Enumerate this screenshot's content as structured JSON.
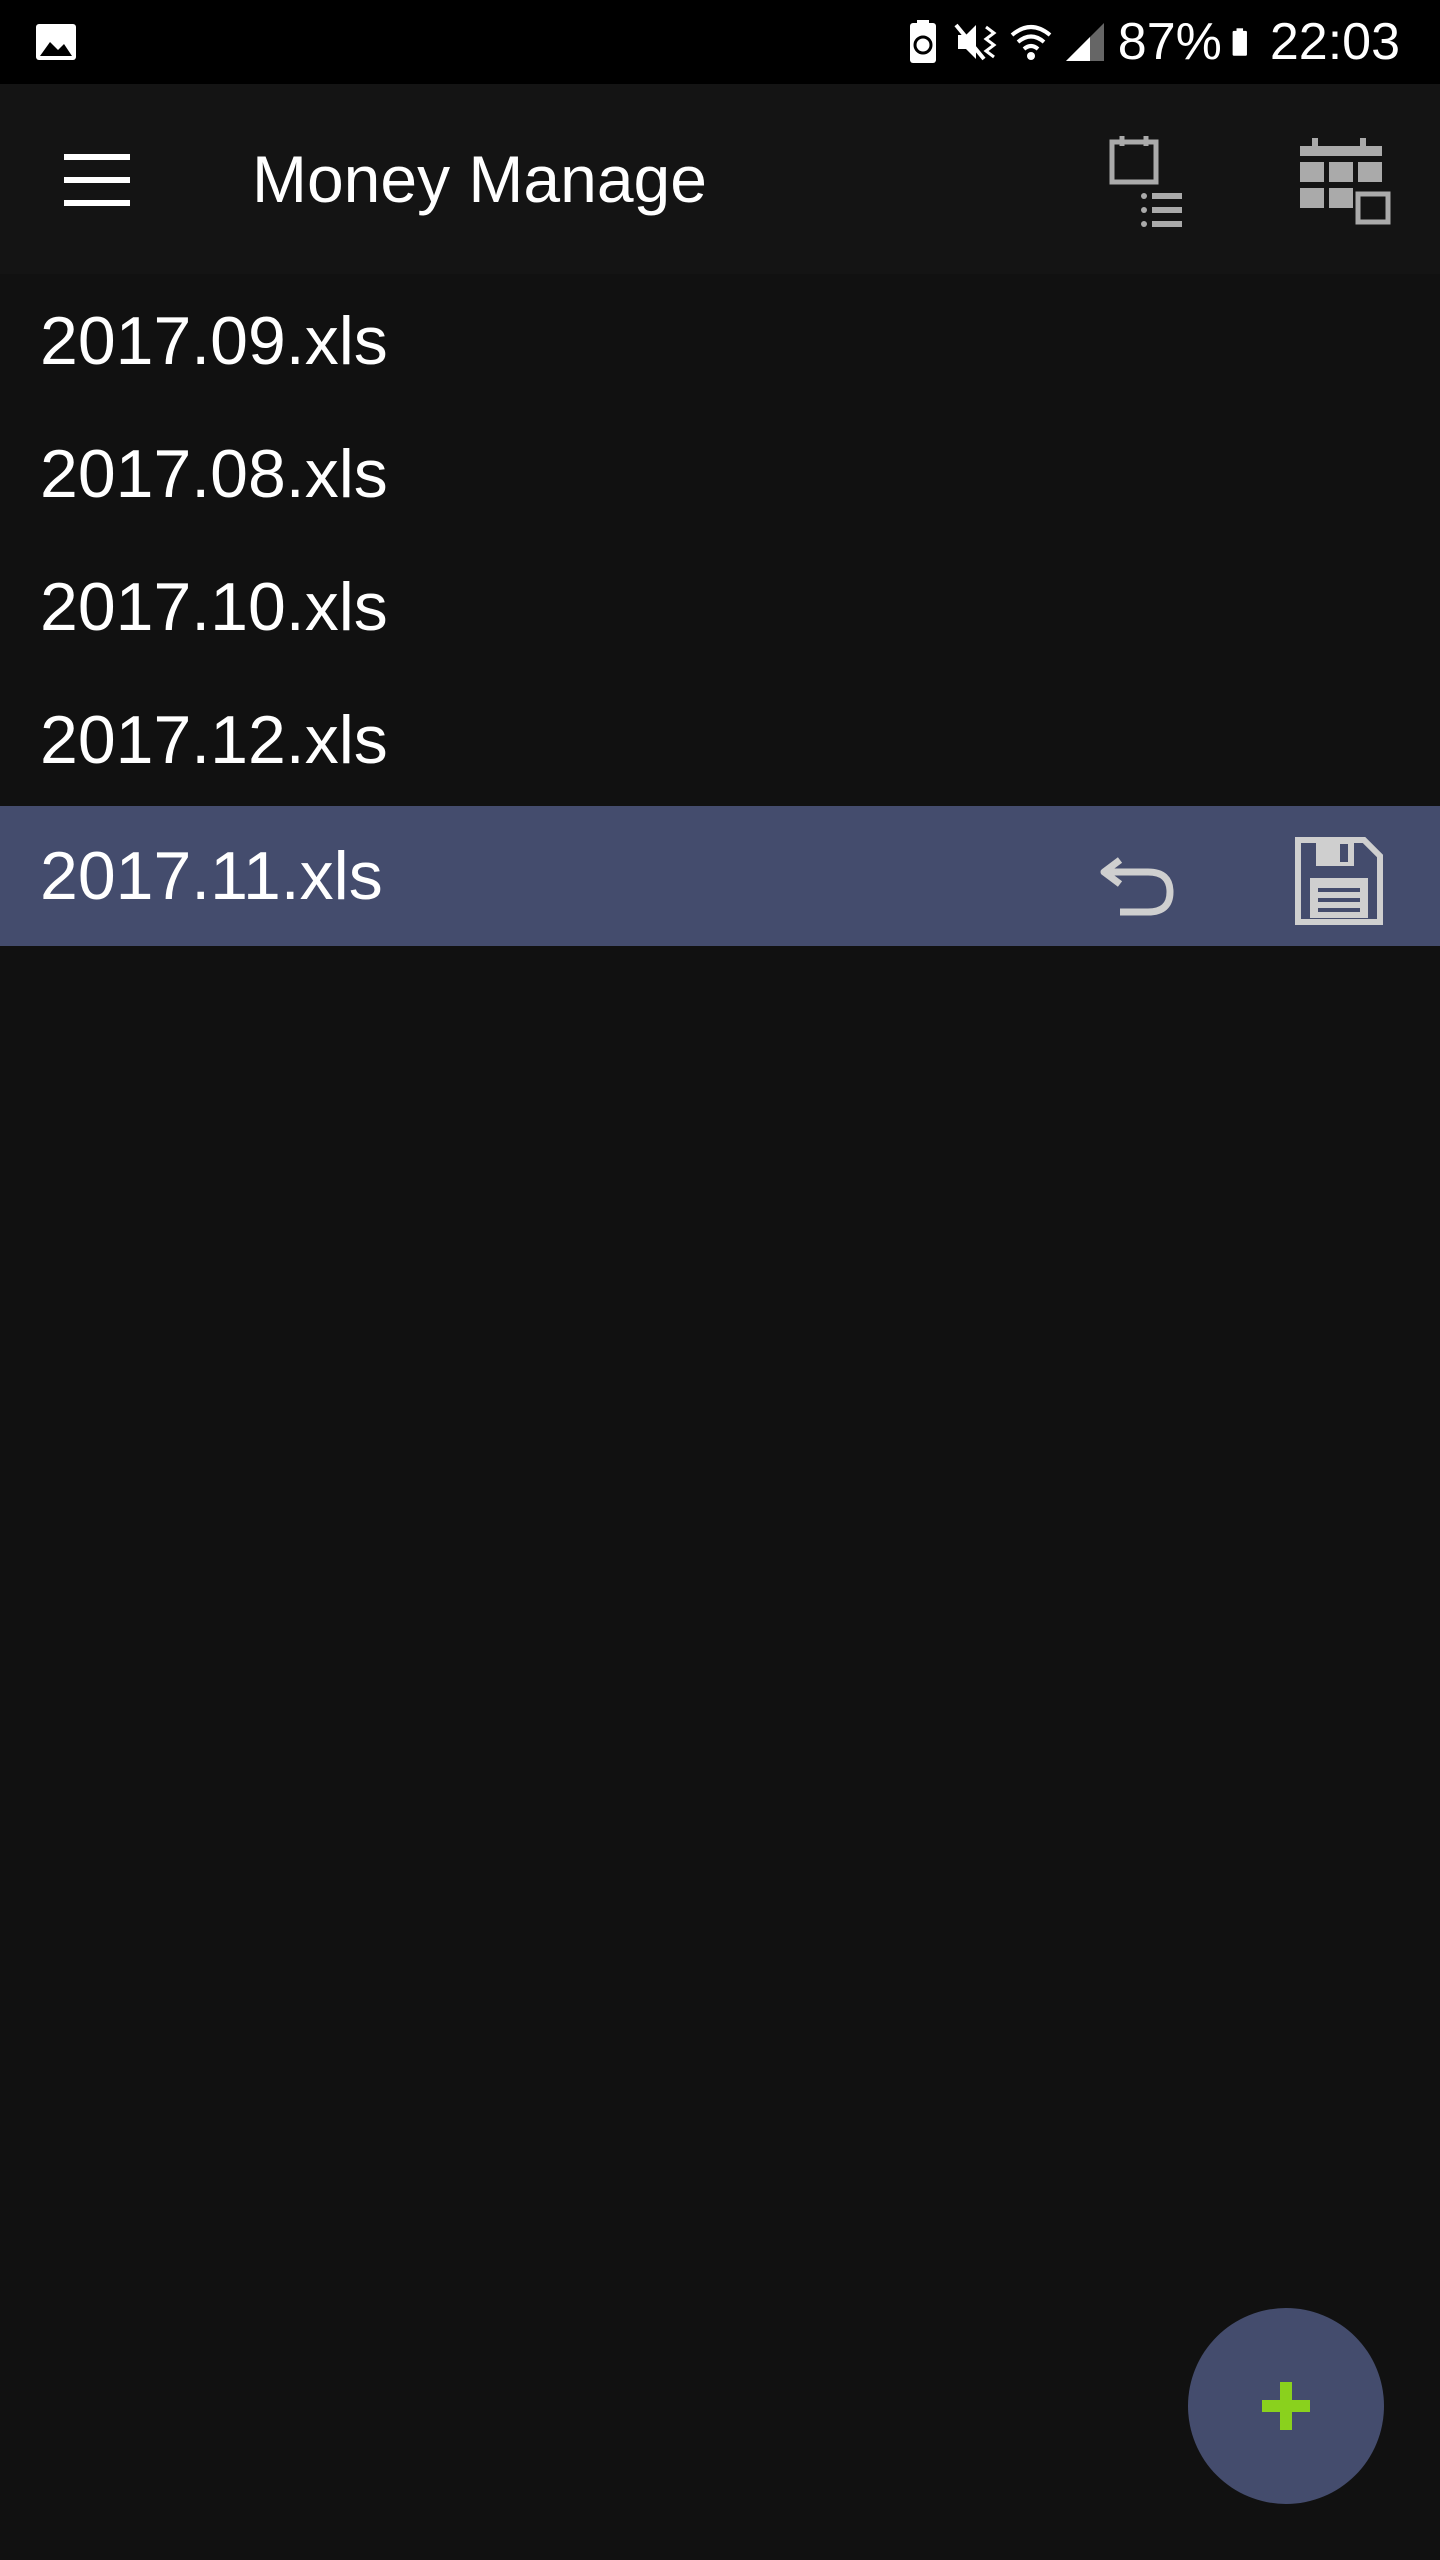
{
  "status_bar": {
    "battery_percent": "87%",
    "time": "22:03"
  },
  "app_bar": {
    "title": "Money Manage"
  },
  "files": [
    {
      "name": "2017.09.xls",
      "selected": false
    },
    {
      "name": "2017.08.xls",
      "selected": false
    },
    {
      "name": "2017.10.xls",
      "selected": false
    },
    {
      "name": "2017.12.xls",
      "selected": false
    },
    {
      "name": "2017.11.xls",
      "selected": true
    }
  ],
  "colors": {
    "background": "#111111",
    "app_bar": "#141414",
    "selected_row": "#444c6d",
    "fab": "#444c6d",
    "fab_plus": "#8ad11d"
  }
}
